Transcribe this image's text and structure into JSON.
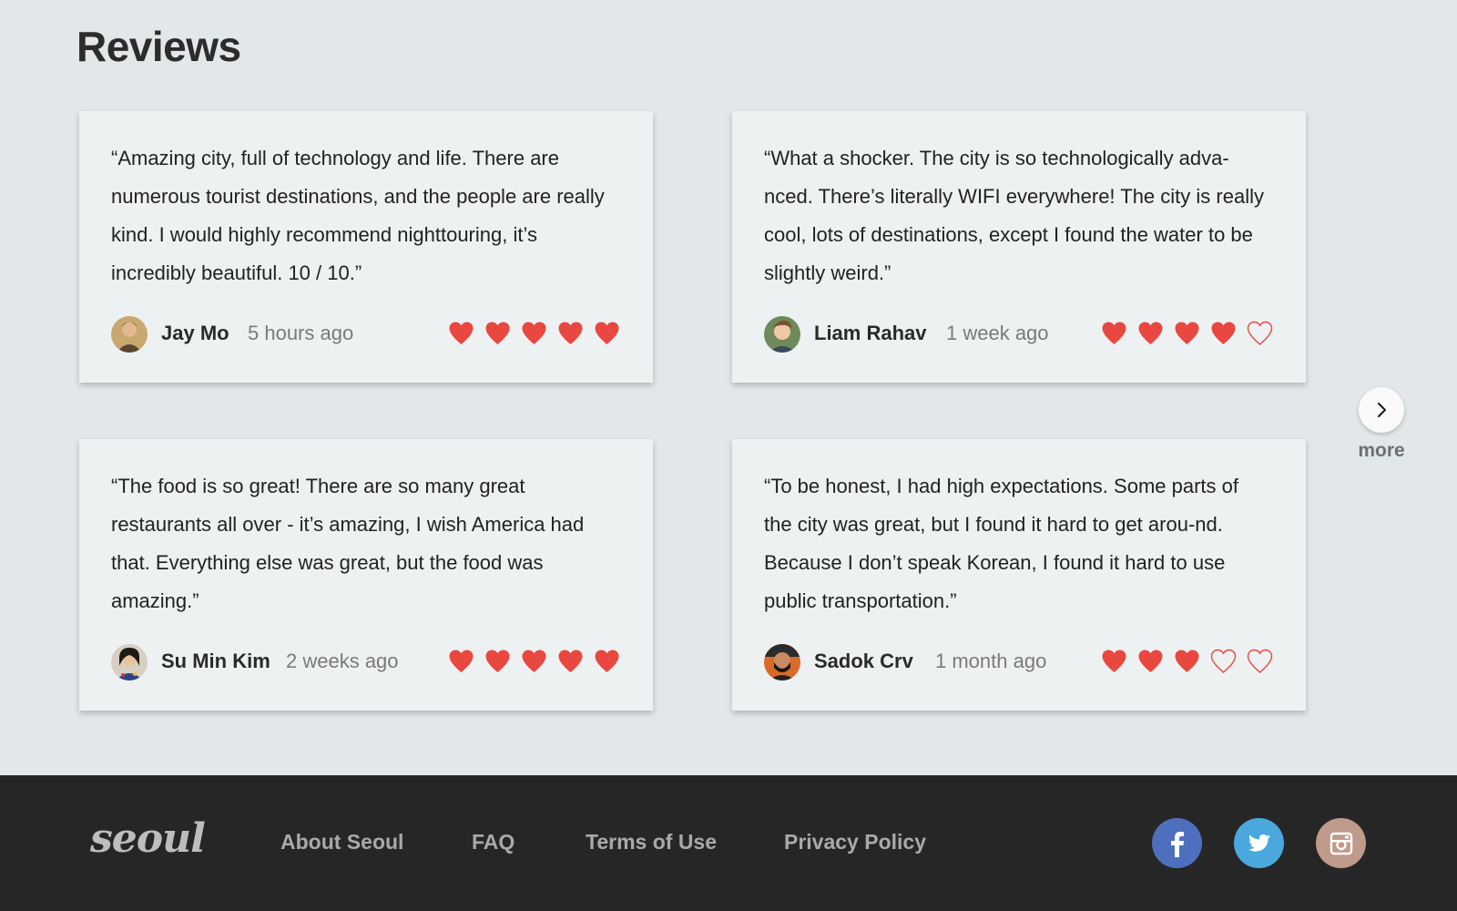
{
  "header": {
    "title": "Reviews"
  },
  "colors": {
    "heart_fill": "#e8483f",
    "card_bg": "#edf1f2",
    "page_bg": "#e2e7e9",
    "footer_bg": "#262626",
    "facebook": "#4e6fbd",
    "twitter": "#4aa8dd",
    "instagram": "#c09a8a"
  },
  "reviews": [
    {
      "text": "“Amazing city, full of technology and life. There are numerous tourist destinations, and the people are really kind. I would highly recommend nighttouring, it’s incredibly beautiful. 10 / 10.”",
      "name": "Jay Mo",
      "time": "5 hours ago",
      "rating": 5,
      "max_rating": 5,
      "avatar_icon": "avatar-jay-mo"
    },
    {
      "text": "“What a shocker. The city is so technologically adva-nced. There’s literally WIFI everywhere! The city is really cool, lots of destinations, except I found the water to be slightly weird.”",
      "name": "Liam Rahav",
      "time": "1 week ago",
      "rating": 4,
      "max_rating": 5,
      "avatar_icon": "avatar-liam-rahav"
    },
    {
      "text": "“The food is so great! There are so many great restaurants all over - it’s amazing, I wish America had that. Everything else was great, but the food was amazing.”",
      "name": "Su Min Kim",
      "time": "2 weeks ago",
      "rating": 5,
      "max_rating": 5,
      "avatar_icon": "avatar-su-min-kim"
    },
    {
      "text": "“To be honest, I had high expectations. Some parts of the city was great, but I found it hard to get arou-nd. Because I don’t speak Korean, I found it hard to use public transportation.”",
      "name": "Sadok Crv",
      "time": "1 month ago",
      "rating": 3,
      "max_rating": 5,
      "avatar_icon": "avatar-sadok-crv"
    }
  ],
  "more": {
    "label": "more",
    "icon": "chevron-right-icon"
  },
  "footer": {
    "logo": "seoul",
    "links": [
      "About Seoul",
      "FAQ",
      "Terms of Use",
      "Privacy Policy"
    ],
    "social": [
      {
        "name": "facebook",
        "icon": "facebook-icon"
      },
      {
        "name": "twitter",
        "icon": "twitter-icon"
      },
      {
        "name": "instagram",
        "icon": "instagram-icon"
      }
    ]
  }
}
